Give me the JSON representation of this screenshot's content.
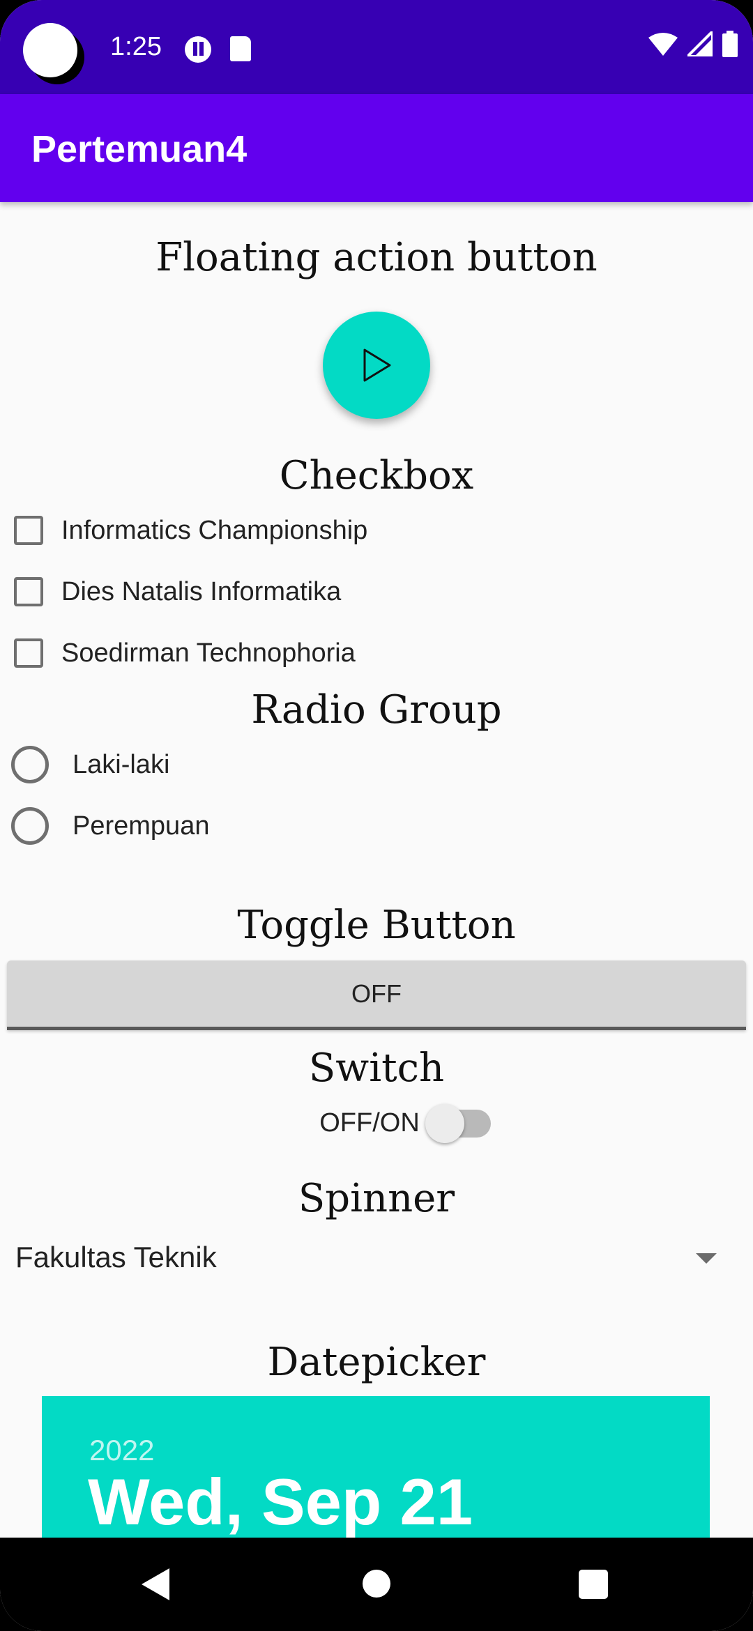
{
  "status_bar": {
    "time": "1:25",
    "icons": [
      "camera-cutout",
      "data-saver-icon",
      "sd-card-icon",
      "wifi-icon",
      "signal-icon",
      "battery-icon"
    ]
  },
  "app_bar": {
    "title": "Pertemuan4"
  },
  "sections": {
    "fab_title": "Floating action button",
    "checkbox_title": "Checkbox",
    "radio_title": "Radio Group",
    "toggle_title": "Toggle Button",
    "switch_title": "Switch",
    "spinner_title": "Spinner",
    "datepicker_title": "Datepicker"
  },
  "fab": {
    "icon": "play-icon",
    "color": "#03dac5"
  },
  "checkboxes": [
    {
      "label": "Informatics Championship",
      "checked": false
    },
    {
      "label": "Dies Natalis Informatika",
      "checked": false
    },
    {
      "label": "Soedirman Technophoria",
      "checked": false
    }
  ],
  "radios": [
    {
      "label": "Laki-laki",
      "selected": false
    },
    {
      "label": "Perempuan",
      "selected": false
    }
  ],
  "toggle": {
    "label": "OFF",
    "state": "off"
  },
  "switch": {
    "label": "OFF/ON",
    "checked": false
  },
  "spinner": {
    "selected": "Fakultas Teknik"
  },
  "datepicker": {
    "year": "2022",
    "date": "Wed, Sep 21",
    "header_color": "#03dac5"
  },
  "colors": {
    "status_bar": "#3700b3",
    "app_bar": "#6200ee",
    "accent": "#03dac5"
  },
  "nav_bar": {
    "icons": [
      "back-icon",
      "home-icon",
      "recents-icon"
    ]
  }
}
